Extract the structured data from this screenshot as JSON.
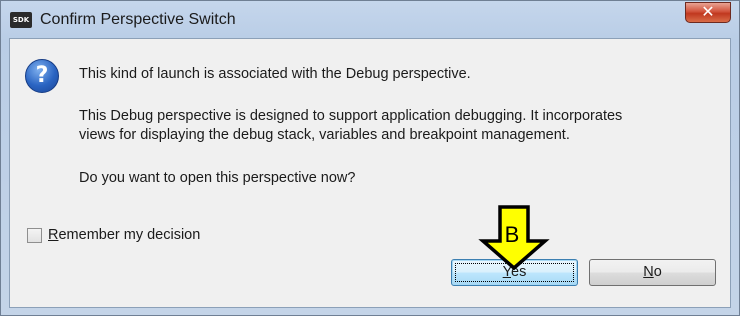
{
  "window": {
    "title": "Confirm Perspective Switch",
    "app_icon_text": "SDK",
    "close_glyph": "✕"
  },
  "dialog": {
    "icon": "question-icon",
    "line1": "This kind of launch is associated with the Debug perspective.",
    "line2": "This Debug perspective is designed to support application debugging.  It incorporates",
    "line3": "views for displaying the debug stack, variables and breakpoint management.",
    "line4": "Do you want to open this perspective now?"
  },
  "remember": {
    "label_prefix": "R",
    "label_rest": "emember my decision",
    "checked": false
  },
  "buttons": {
    "yes": {
      "mnemonic": "Y",
      "rest": "es"
    },
    "no": {
      "mnemonic": "N",
      "rest": "o"
    }
  },
  "annotation": {
    "label": "B",
    "color": "#ffff00",
    "icon": "arrow-down-icon"
  }
}
